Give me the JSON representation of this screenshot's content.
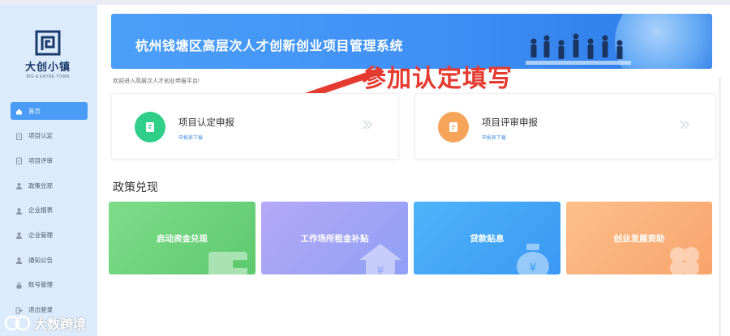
{
  "logo": {
    "name": "大创小镇",
    "sub": "BIG & ENTRE TOWN"
  },
  "sidebar": {
    "items": [
      {
        "label": "首页",
        "icon": "home-icon",
        "active": true
      },
      {
        "label": "项目认定",
        "icon": "doc-icon",
        "active": false
      },
      {
        "label": "项目评审",
        "icon": "doc-icon",
        "active": false
      },
      {
        "label": "政策兑现",
        "icon": "person-icon",
        "active": false
      },
      {
        "label": "企业报表",
        "icon": "person-icon",
        "active": false
      },
      {
        "label": "企业管理",
        "icon": "person-icon",
        "active": false
      },
      {
        "label": "通知公告",
        "icon": "person-icon",
        "active": false
      },
      {
        "label": "账号管理",
        "icon": "lock-icon",
        "active": false
      },
      {
        "label": "退出登录",
        "icon": "exit-icon",
        "active": false
      }
    ]
  },
  "banner": {
    "title": "杭州钱塘区高层次人才创新创业项目管理系统"
  },
  "annotation": {
    "text": "参加认定填写"
  },
  "welcome": "欢迎进入高层次人才创业申报平台!",
  "cards": [
    {
      "title": "项目认定申报",
      "link": "申报表下载",
      "color": "#2fcf8a"
    },
    {
      "title": "项目评审申报",
      "link": "申报表下载",
      "color": "#f6a45a"
    }
  ],
  "section": {
    "title": "政策兑现"
  },
  "tiles": [
    {
      "label": "启动资金兑现",
      "from": "#7ddc8a",
      "to": "#5ec96f"
    },
    {
      "label": "工作场所租金补贴",
      "from": "#b6a8f7",
      "to": "#8fa0f6"
    },
    {
      "label": "贷款贴息",
      "from": "#4fb4fb",
      "to": "#3a98f3"
    },
    {
      "label": "创业发展资助",
      "from": "#fcc08b",
      "to": "#f9a36c"
    }
  ],
  "watermark": {
    "text": "大数跨境"
  }
}
